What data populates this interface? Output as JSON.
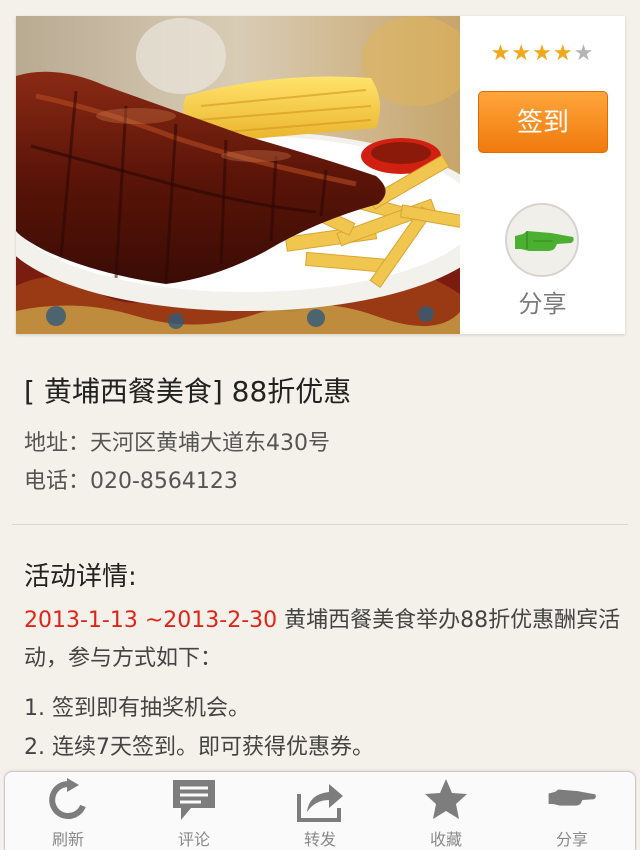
{
  "header_card": {
    "rating": 4,
    "rating_max": 5,
    "star_on_color": "#f0a81c",
    "star_off_color": "#b5b5b5",
    "checkin_label": "签到",
    "share_label": "分享",
    "share_icon": "hand-pointing-icon",
    "accent_color": "#f07a0c"
  },
  "info": {
    "title": "[ 黄埔西餐美食] 88折优惠",
    "address": "地址：天河区黄埔大道东430号",
    "phone": "电话：020-8564123"
  },
  "details": {
    "heading": "活动详情:",
    "date_range": "2013-1-13 ~2013-2-30",
    "description": " 黄埔西餐美食举办88折优惠酬宾活动，参与方式如下：",
    "items": [
      "1. 签到即有抽奖机会。",
      "2. 连续7天签到。即可获得优惠券。"
    ],
    "date_color": "#e02419"
  },
  "tab_bar": {
    "tabs": [
      {
        "label": "刷新",
        "icon": "refresh-icon"
      },
      {
        "label": "评论",
        "icon": "comment-icon"
      },
      {
        "label": "转发",
        "icon": "forward-icon"
      },
      {
        "label": "收藏",
        "icon": "star-icon"
      },
      {
        "label": "分享",
        "icon": "share-hand-icon"
      }
    ]
  }
}
